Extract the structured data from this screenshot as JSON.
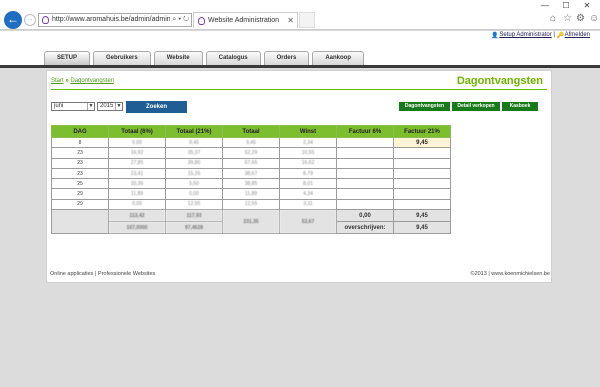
{
  "browser": {
    "url": "http://www.aromahuis.be/admin/admin.a",
    "tab_title": "Website Administration",
    "window_controls": [
      "—",
      "☐",
      "✕"
    ]
  },
  "header": {
    "user_label": "Setup Administrator",
    "separator": "|",
    "logout_label": "Afmelden"
  },
  "menu": [
    "SETUP",
    "Gebruikers",
    "Website",
    "Catalogus",
    "Orders",
    "Aankoop"
  ],
  "breadcrumb": {
    "home": "Start",
    "sep": "»",
    "current": "Dagontvangsten"
  },
  "page_title": "Dagontvangsten",
  "filters": {
    "month": "juni",
    "year": "2015",
    "search_label": "Zoeken"
  },
  "actions": [
    "Dagontvangsten",
    "Detail verkopen",
    "Kasboek"
  ],
  "table": {
    "columns": [
      "DAG",
      "Totaal (6%)",
      "Totaal (21%)",
      "Totaal",
      "Winst",
      "Factuur 6%",
      "Factuur 21%"
    ],
    "rows": [
      [
        "8",
        "0,00",
        "9,45",
        "9,45",
        "2,34",
        "",
        "9,45"
      ],
      [
        "23",
        "16,92",
        "35,37",
        "52,29",
        "10,55",
        "",
        ""
      ],
      [
        "23",
        "27,85",
        "39,80",
        "67,65",
        "16,62",
        "",
        ""
      ],
      [
        "23",
        "23,41",
        "15,26",
        "38,67",
        "8,79",
        "",
        ""
      ],
      [
        "25",
        "33,35",
        "5,50",
        "38,85",
        "8,01",
        "",
        ""
      ],
      [
        "29",
        "11,89",
        "0,00",
        "11,89",
        "4,34",
        "",
        ""
      ],
      [
        "29",
        "0,00",
        "12,55",
        "12,55",
        "3,11",
        "",
        ""
      ]
    ],
    "totals": {
      "t6": "113,42",
      "t21": "117,93",
      "t6b": "107,0000",
      "t21b": "97,4628",
      "total": "231,35",
      "winst": "53,67",
      "f6": "0,00",
      "f21": "9,45",
      "overschrijven_label": "overschrijven:",
      "overschrijven_value": "9,45"
    }
  },
  "footer": {
    "left": "Online applicaties | Professionele Websites",
    "right": "©2013 | www.koenmichielsen.be"
  }
}
